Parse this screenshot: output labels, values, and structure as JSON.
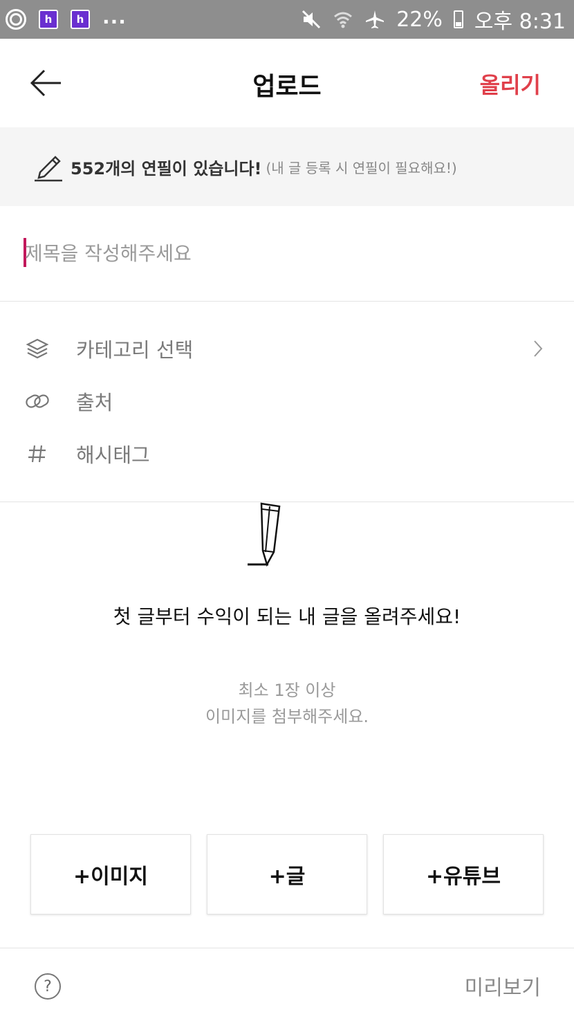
{
  "status_bar": {
    "left_icons": [
      "settings-icon",
      "app-icon",
      "app-icon"
    ],
    "app_icon_letter": "h",
    "more": "...",
    "battery_percent": "22%",
    "time": "오후 8:31"
  },
  "header": {
    "title": "업로드",
    "action_label": "올리기",
    "action_color": "#e0404b"
  },
  "banner": {
    "highlight": "552개의 연필이 있습니다!",
    "note": "(내 글 등록 시 연필이 필요해요!)"
  },
  "title_input": {
    "placeholder": "제목을 작성해주세요",
    "value": ""
  },
  "options": [
    {
      "icon": "layers-icon",
      "label": "카테고리 선택"
    },
    {
      "icon": "link-icon",
      "label": "출처"
    },
    {
      "icon": "hash-icon",
      "label": "해시태그"
    }
  ],
  "empty_state": {
    "main": "첫 글부터 수익이 되는 내 글을 올려주세요!",
    "sub_line1": "최소 1장 이상",
    "sub_line2": "이미지를 첨부해주세요."
  },
  "add_buttons": {
    "image": "+이미지",
    "text": "+글",
    "youtube": "+유튜브"
  },
  "footer": {
    "help_symbol": "?",
    "preview_label": "미리보기"
  }
}
